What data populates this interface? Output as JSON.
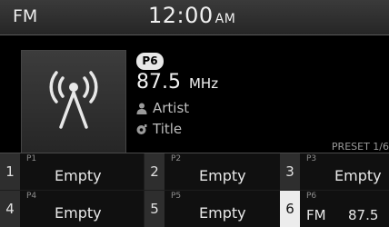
{
  "status": {
    "mode": "FM",
    "time": "12:00",
    "ampm": "AM"
  },
  "now_playing": {
    "preset_badge": "P6",
    "frequency": "87.5",
    "unit": "MHz",
    "artist": "Artist",
    "title": "Title",
    "icons": [
      "radio-broadcast-icon",
      "person-icon",
      "music-note-icon"
    ]
  },
  "preset_page": "PRESET 1/6",
  "presets": [
    {
      "num": "1",
      "label": "P1",
      "value": "Empty",
      "active": false
    },
    {
      "num": "2",
      "label": "P2",
      "value": "Empty",
      "active": false
    },
    {
      "num": "3",
      "label": "P3",
      "value": "Empty",
      "active": false
    },
    {
      "num": "4",
      "label": "P4",
      "value": "Empty",
      "active": false
    },
    {
      "num": "5",
      "label": "P5",
      "value": "Empty",
      "active": false
    },
    {
      "num": "6",
      "label": "P6",
      "band": "FM",
      "freq": "87.5",
      "active": true
    }
  ],
  "colors": {
    "background": "#000000",
    "statusbar": "#2e2e2e",
    "active_preset": "#ececec"
  }
}
